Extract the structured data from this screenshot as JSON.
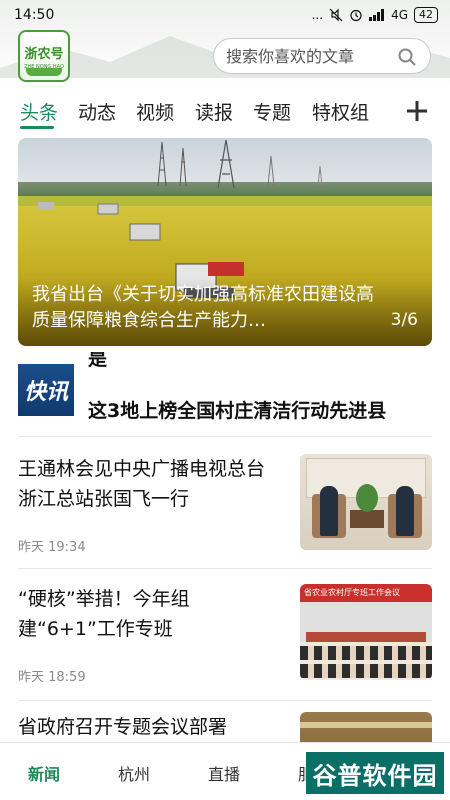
{
  "status_bar": {
    "time": "14:50",
    "dots": "...",
    "network": "4G",
    "battery": "42"
  },
  "header": {
    "logo_text": "浙农号",
    "logo_subtext": "ZHE NONG HAO",
    "search_placeholder": "搜索你喜欢的文章"
  },
  "tabs": [
    {
      "label": "头条",
      "active": true
    },
    {
      "label": "动态"
    },
    {
      "label": "视频"
    },
    {
      "label": "读报"
    },
    {
      "label": "专题"
    },
    {
      "label": "特权组"
    }
  ],
  "banner": {
    "title": "我省出台《关于切实加强高标准农田建设高质量保障粮食综合生产能力…",
    "counter": "3/6"
  },
  "flash": {
    "logo_text": "快讯",
    "prev_text": "是",
    "text": "这3地上榜全国村庄清洁行动先进县"
  },
  "news": [
    {
      "headline": "王通林会见中央广播电视总台浙江总站张国飞一行",
      "time": "昨天 19:34"
    },
    {
      "headline": "“硬核”举措！今年组建“6+1”工作专班",
      "time": "昨天 18:59",
      "thumb_banner": "省农业农村厅专班工作会议"
    },
    {
      "headline": "省政府召开专题会议部署"
    }
  ],
  "bottom_nav": [
    {
      "label": "新闻",
      "active": true
    },
    {
      "label": "杭州"
    },
    {
      "label": "直播"
    },
    {
      "label": "服"
    }
  ],
  "watermark": "谷普软件园",
  "colors": {
    "accent": "#1f8a5b",
    "logo_green": "#3a8c2d",
    "flash_blue": "#1b4e8c"
  }
}
